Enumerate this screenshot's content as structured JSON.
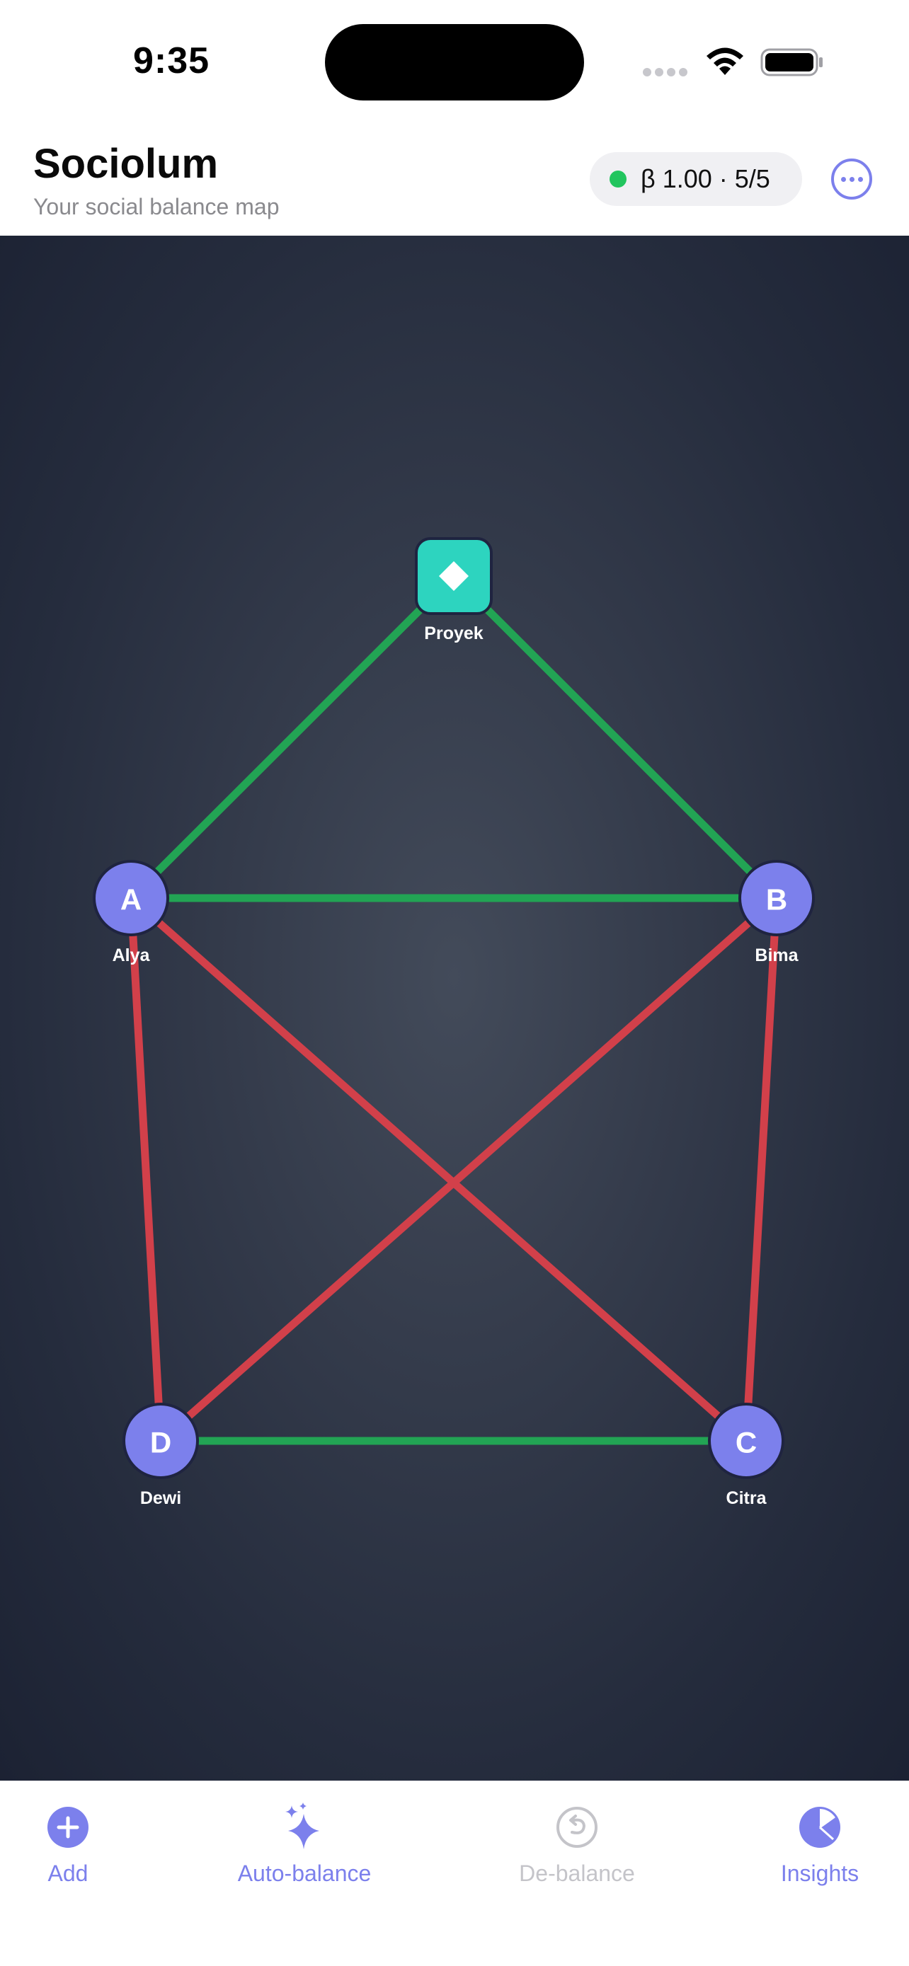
{
  "status_bar": {
    "time": "9:35"
  },
  "header": {
    "title": "Sociolum",
    "subtitle": "Your social balance map",
    "balance_badge": "β 1.00 · 5/5",
    "balance_status_color": "#22c55e"
  },
  "graph": {
    "nodes": [
      {
        "id": "P",
        "label": "Proyek",
        "shape": "diamond-square",
        "icon": "diamond-icon",
        "color": "#2dd4bf"
      },
      {
        "id": "A",
        "label": "Alya",
        "shape": "circle",
        "color": "#7c80ec"
      },
      {
        "id": "B",
        "label": "Bima",
        "shape": "circle",
        "color": "#7c80ec"
      },
      {
        "id": "C",
        "label": "Citra",
        "shape": "circle",
        "color": "#7c80ec"
      },
      {
        "id": "D",
        "label": "Dewi",
        "shape": "circle",
        "color": "#7c80ec"
      }
    ],
    "edges": [
      {
        "from": "P",
        "to": "A",
        "sign": "positive"
      },
      {
        "from": "P",
        "to": "B",
        "sign": "positive"
      },
      {
        "from": "A",
        "to": "B",
        "sign": "positive"
      },
      {
        "from": "D",
        "to": "C",
        "sign": "positive"
      },
      {
        "from": "A",
        "to": "D",
        "sign": "negative"
      },
      {
        "from": "A",
        "to": "C",
        "sign": "negative"
      },
      {
        "from": "B",
        "to": "D",
        "sign": "negative"
      },
      {
        "from": "B",
        "to": "C",
        "sign": "negative"
      }
    ],
    "colors": {
      "positive": "#22a454",
      "negative": "#d2404a"
    }
  },
  "tab_bar": {
    "tabs": [
      {
        "label": "Add",
        "icon": "plus-circle-icon",
        "state": "active"
      },
      {
        "label": "Auto-balance",
        "icon": "sparkles-icon",
        "state": "active"
      },
      {
        "label": "De-balance",
        "icon": "undo-circle-icon",
        "state": "disabled"
      },
      {
        "label": "Insights",
        "icon": "pie-chart-icon",
        "state": "active"
      }
    ],
    "accent": "#7c80ec",
    "disabled": "#c4c4c9"
  }
}
